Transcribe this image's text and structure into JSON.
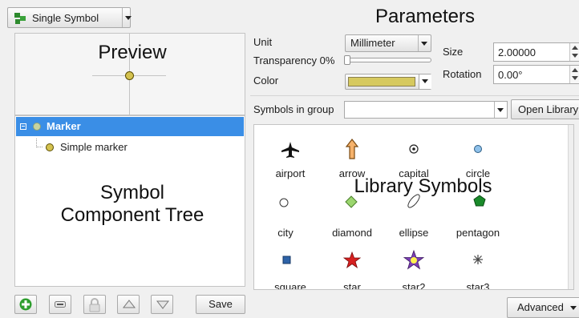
{
  "symbol_type": {
    "label": "Single Symbol"
  },
  "annotations": {
    "parameters": "Parameters",
    "preview": "Preview",
    "tree_line1": "Symbol",
    "tree_line2": "Component Tree",
    "library": "Library Symbols"
  },
  "tree": {
    "root_label": "Marker",
    "child_label": "Simple marker"
  },
  "toolbar": {
    "save_label": "Save"
  },
  "params": {
    "unit_label": "Unit",
    "unit_value": "Millimeter",
    "transparency_label": "Transparency 0%",
    "color_label": "Color",
    "color_value": "#d6c95f",
    "size_label": "Size",
    "size_value": "2.00000",
    "rotation_label": "Rotation",
    "rotation_value": "0.00°"
  },
  "group": {
    "label": "Symbols in group",
    "value": "",
    "open_library_label": "Open Library"
  },
  "library": {
    "symbols": [
      {
        "name": "airport",
        "icon": "airplane-icon"
      },
      {
        "name": "arrow",
        "icon": "arrow-up-icon"
      },
      {
        "name": "capital",
        "icon": "capital-dot-icon"
      },
      {
        "name": "circle",
        "icon": "circle-icon"
      },
      {
        "name": "city",
        "icon": "city-circle-icon"
      },
      {
        "name": "diamond",
        "icon": "diamond-icon"
      },
      {
        "name": "ellipse",
        "icon": "ellipse-icon"
      },
      {
        "name": "pentagon",
        "icon": "pentagon-icon"
      },
      {
        "name": "square",
        "icon": "square-icon"
      },
      {
        "name": "star",
        "icon": "star-icon"
      },
      {
        "name": "star2",
        "icon": "star2-icon"
      },
      {
        "name": "star3",
        "icon": "star3-icon"
      }
    ]
  },
  "advanced_label": "Advanced"
}
